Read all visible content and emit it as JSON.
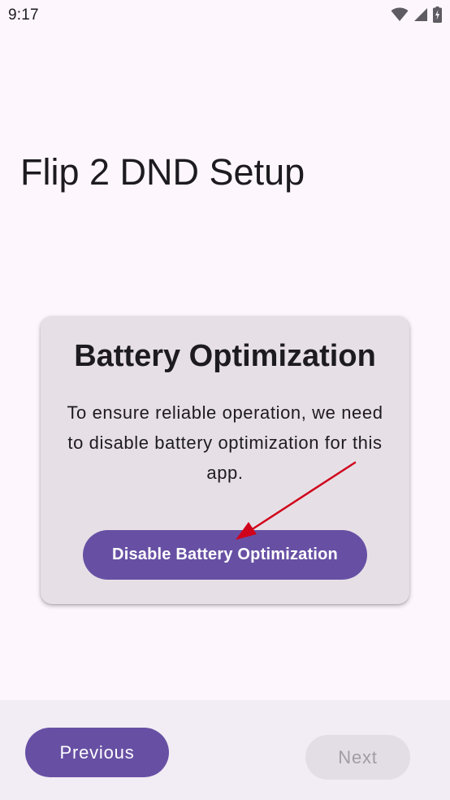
{
  "status_bar": {
    "time": "9:17",
    "icons": [
      "wifi-icon",
      "cellular-signal-icon",
      "battery-charging-icon"
    ]
  },
  "page": {
    "title": "Flip 2 DND Setup"
  },
  "card": {
    "title": "Battery Optimization",
    "body": "To ensure reliable operation, we need to disable battery optimization for this app.",
    "action_label": "Disable Battery Optimization"
  },
  "navigation": {
    "previous_label": "Previous",
    "next_label": "Next",
    "next_enabled": false
  },
  "colors": {
    "background": "#fdf7fd",
    "card": "#e6e0e6",
    "primary": "#6750a4",
    "bottom_bar": "#f2ecf4",
    "disabled_button": "#e3dde5",
    "disabled_text": "#a19ca5",
    "annotation_arrow": "#d0021b"
  }
}
